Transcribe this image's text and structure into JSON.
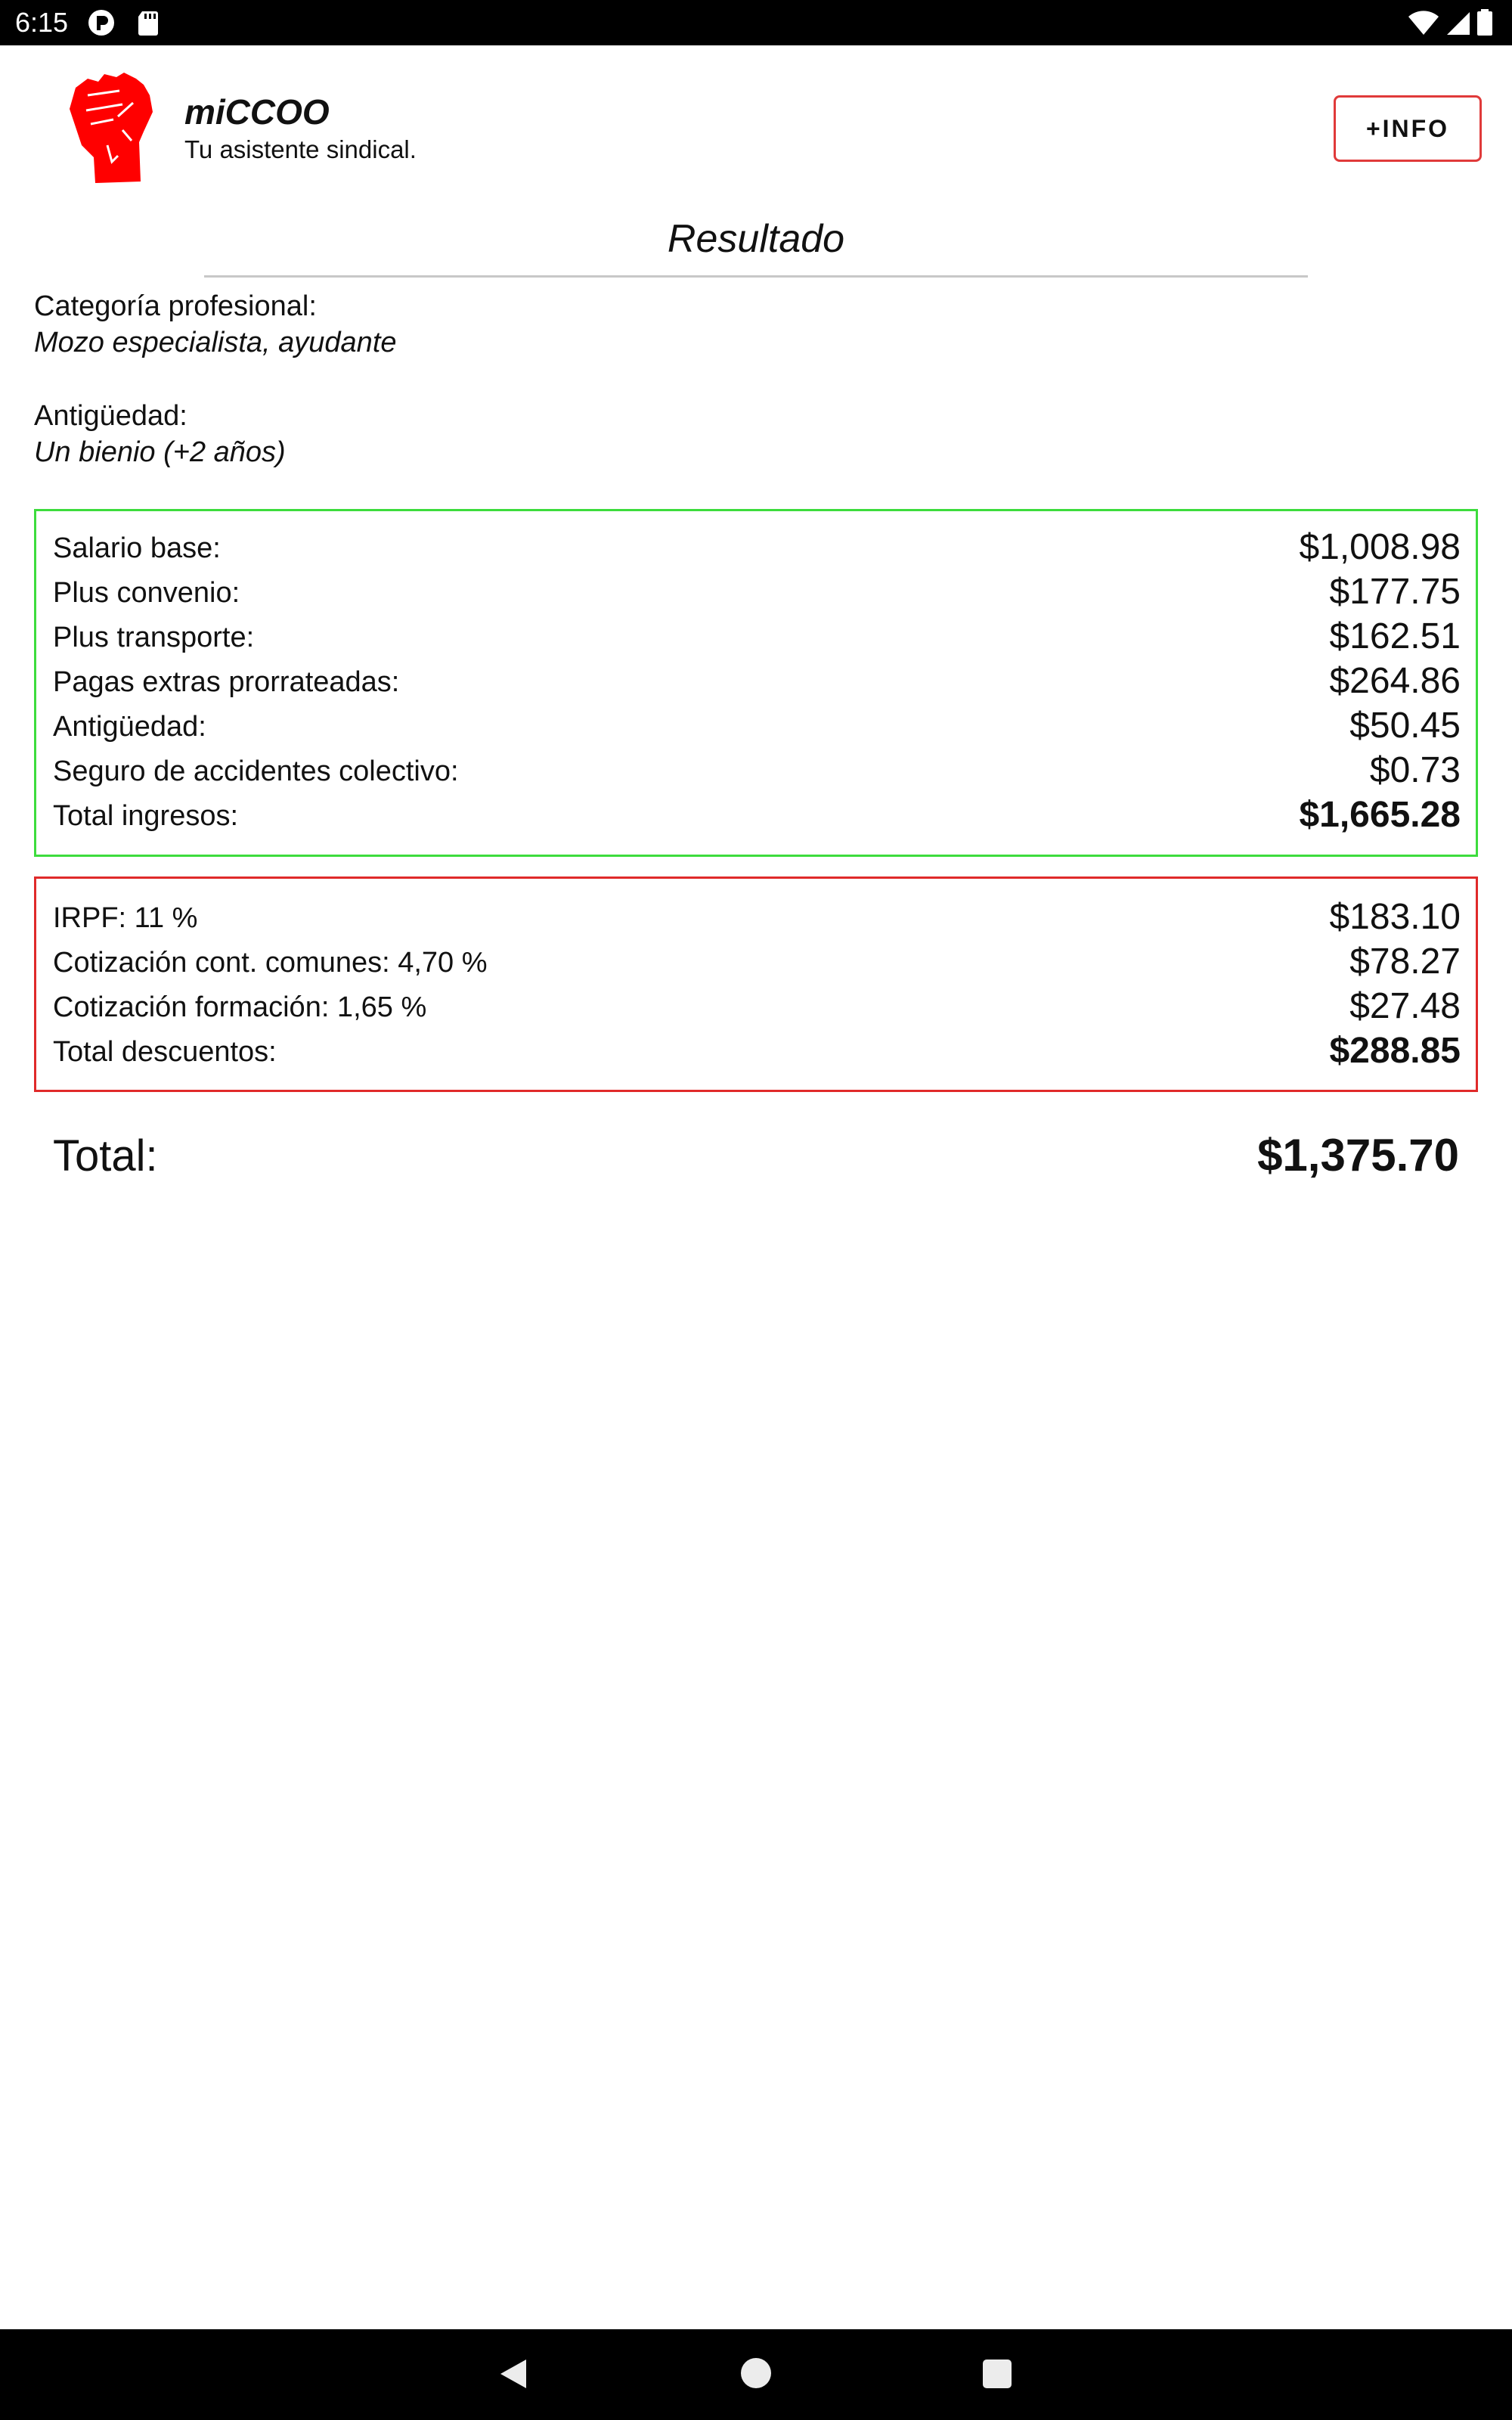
{
  "status_bar": {
    "time": "6:15",
    "left_icons": [
      "notification-app-icon",
      "sd-card-icon"
    ],
    "right_icons": [
      "wifi-icon",
      "signal-icon",
      "battery-icon"
    ]
  },
  "header": {
    "app_name": "miCCOO",
    "tagline": "Tu asistente sindical.",
    "info_button": "+INFO",
    "logo_icon": "raised-fist-icon",
    "brand_color": "#ff0000"
  },
  "result": {
    "title": "Resultado",
    "category_label": "Categoría profesional:",
    "category_value": "Mozo especialista, ayudante",
    "seniority_label": "Antigüedad:",
    "seniority_value": "Un bienio (+2 años)"
  },
  "income": {
    "border_color": "#3ddc3d",
    "rows": [
      {
        "label": "Salario base:",
        "value": "$1,008.98"
      },
      {
        "label": "Plus convenio:",
        "value": "$177.75"
      },
      {
        "label": "Plus transporte:",
        "value": "$162.51"
      },
      {
        "label": "Pagas extras prorrateadas:",
        "value": "$264.86"
      },
      {
        "label": "Antigüedad:",
        "value": "$50.45"
      },
      {
        "label": "Seguro de accidentes colectivo:",
        "value": "$0.73"
      }
    ],
    "total_label": "Total ingresos:",
    "total_value": "$1,665.28"
  },
  "deductions": {
    "border_color": "#e02a2a",
    "rows": [
      {
        "label": "IRPF: 11 %",
        "value": "$183.10"
      },
      {
        "label": "Cotización cont. comunes: 4,70 %",
        "value": "$78.27"
      },
      {
        "label": "Cotización formación: 1,65 %",
        "value": "$27.48"
      }
    ],
    "total_label": "Total descuentos:",
    "total_value": "$288.85"
  },
  "grand_total": {
    "label": "Total:",
    "value": "$1,375.70"
  },
  "nav_bar": {
    "buttons": [
      "back-icon",
      "home-icon",
      "recents-icon"
    ]
  }
}
